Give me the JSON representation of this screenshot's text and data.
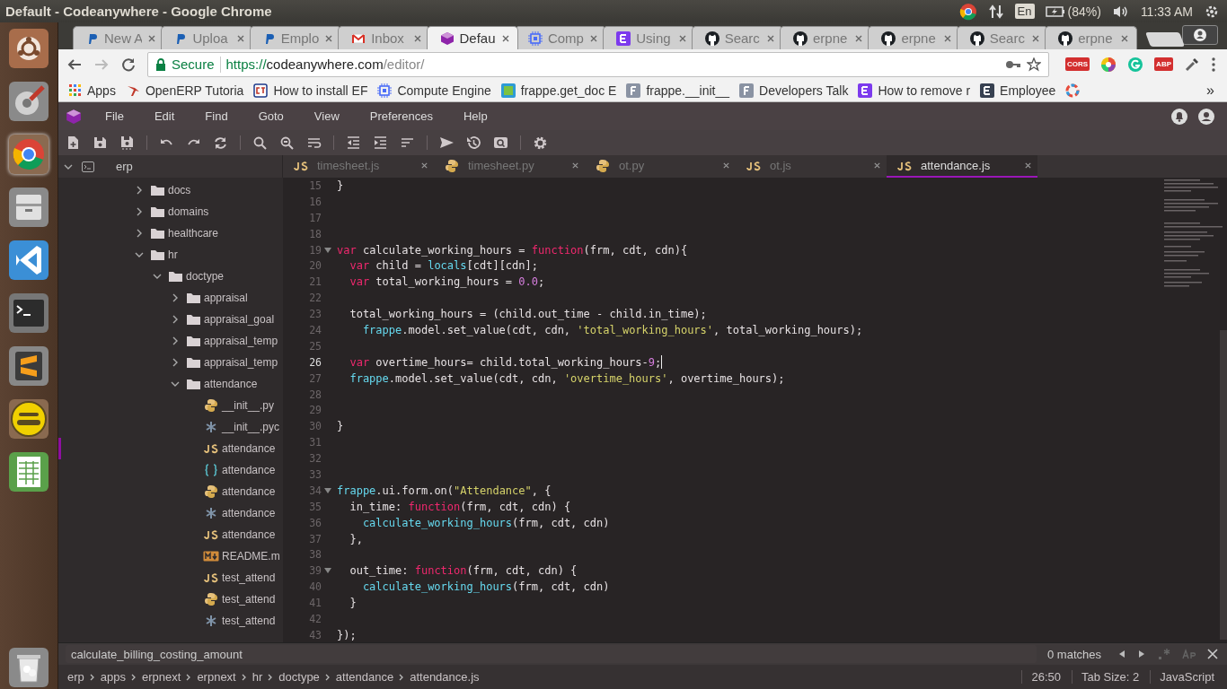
{
  "system_bar": {
    "title": "Default - Codeanywhere - Google Chrome",
    "keyboard": "En",
    "battery": "(84%)",
    "clock": "11:33 AM"
  },
  "launcher": [
    {
      "kind": "ubuntu",
      "selected": false
    },
    {
      "kind": "settings",
      "selected": false
    },
    {
      "kind": "chrome",
      "selected": true
    },
    {
      "kind": "files",
      "selected": false
    },
    {
      "kind": "vscode",
      "selected": false
    },
    {
      "kind": "terminal",
      "selected": false
    },
    {
      "kind": "sublime",
      "selected": false
    },
    {
      "kind": "badge",
      "selected": false
    },
    {
      "kind": "spreadsheet",
      "selected": false
    },
    {
      "kind": "trash",
      "selected": false
    }
  ],
  "browser": {
    "tabs": [
      {
        "label": "New A",
        "kind": "p",
        "selected": false
      },
      {
        "label": "Uploa",
        "kind": "p",
        "selected": false
      },
      {
        "label": "Emplo",
        "kind": "p",
        "selected": false
      },
      {
        "label": "Inbox",
        "kind": "mail",
        "selected": false
      },
      {
        "label": "Defau",
        "kind": "cube",
        "selected": true
      },
      {
        "label": "Comp",
        "kind": "chip",
        "selected": false
      },
      {
        "label": "Using",
        "kind": "e",
        "selected": false
      },
      {
        "label": "Searc",
        "kind": "github",
        "selected": false
      },
      {
        "label": "erpne",
        "kind": "github",
        "selected": false
      },
      {
        "label": "erpne",
        "kind": "github",
        "selected": false
      },
      {
        "label": "Searc",
        "kind": "github",
        "selected": false
      },
      {
        "label": "erpne",
        "kind": "github",
        "selected": false
      }
    ],
    "security": "Secure",
    "url": {
      "scheme": "https://",
      "host": "codeanywhere.com",
      "path": "/editor/"
    },
    "extensions": [
      {
        "kind": "badge",
        "label": "CORS"
      },
      {
        "kind": "color"
      },
      {
        "kind": "grammar"
      },
      {
        "kind": "badge",
        "label": "ABP"
      },
      {
        "kind": "dropper"
      }
    ],
    "bookmarks": [
      {
        "label": "Apps",
        "kind": "apps"
      },
      {
        "label": "OpenERP Tutoria",
        "kind": "bird"
      },
      {
        "label": "How to install EF",
        "kind": "ct"
      },
      {
        "label": "Compute Engine",
        "kind": "chip"
      },
      {
        "label": "frappe.get_doc E",
        "kind": "pt"
      },
      {
        "label": "frappe.__init__",
        "kind": "f"
      },
      {
        "label": "Developers Talk",
        "kind": "f"
      },
      {
        "label": "How to remove r",
        "kind": "e"
      },
      {
        "label": "Employee",
        "kind": "edark"
      },
      {
        "kind": "ring"
      }
    ],
    "more": "»"
  },
  "menu": [
    "File",
    "Edit",
    "Find",
    "Goto",
    "View",
    "Preferences",
    "Help"
  ],
  "file_tree": {
    "root": {
      "name": "erp",
      "expanded": true
    },
    "items": [
      {
        "name": "docs",
        "expanded": false
      },
      {
        "name": "domains",
        "expanded": false
      },
      {
        "name": "healthcare",
        "expanded": false
      },
      {
        "name": "hr",
        "expanded": true,
        "children": [
          {
            "name": "doctype",
            "expanded": true,
            "children": [
              {
                "name": "appraisal",
                "expanded": false
              },
              {
                "name": "appraisal_goal",
                "expanded": false
              },
              {
                "name": "appraisal_temp",
                "expanded": false
              },
              {
                "name": "appraisal_temp",
                "expanded": false
              },
              {
                "name": "attendance",
                "expanded": true,
                "children": [
                  {
                    "name": "__init__.py",
                    "kind": "python",
                    "selected": false
                  },
                  {
                    "name": "__init__.pyc",
                    "kind": "compiled",
                    "selected": false
                  },
                  {
                    "name": "attendance",
                    "kind": "js",
                    "selected": true
                  },
                  {
                    "name": "attendance",
                    "kind": "json",
                    "selected": false
                  },
                  {
                    "name": "attendance",
                    "kind": "python",
                    "selected": false
                  },
                  {
                    "name": "attendance",
                    "kind": "compiled",
                    "selected": false
                  },
                  {
                    "name": "attendance",
                    "kind": "js",
                    "selected": false
                  },
                  {
                    "name": "README.m",
                    "kind": "markdown",
                    "selected": false
                  },
                  {
                    "name": "test_attend",
                    "kind": "js",
                    "selected": false
                  },
                  {
                    "name": "test_attend",
                    "kind": "python",
                    "selected": false
                  },
                  {
                    "name": "test_attend",
                    "kind": "compiled",
                    "selected": false
                  }
                ]
              }
            ]
          }
        ]
      }
    ]
  },
  "editor_tabs": [
    {
      "label": "timesheet.js",
      "kind": "js",
      "selected": false
    },
    {
      "label": "timesheet.py",
      "kind": "python",
      "selected": false
    },
    {
      "label": "ot.py",
      "kind": "python",
      "selected": false
    },
    {
      "label": "ot.js",
      "kind": "js",
      "selected": false
    },
    {
      "label": "attendance.js",
      "kind": "js",
      "selected": true
    }
  ],
  "code_lines": [
    {
      "n": "15",
      "fold": false,
      "current": false,
      "tokens": [
        {
          "text": "}",
          "kind": "plain"
        }
      ]
    },
    {
      "n": "16",
      "fold": false,
      "current": false
    },
    {
      "n": "17",
      "fold": false,
      "current": false
    },
    {
      "n": "18",
      "fold": false,
      "current": false
    },
    {
      "n": "19",
      "fold": true,
      "current": false,
      "tokens": [
        {
          "text": "var",
          "kind": "keyword"
        },
        {
          "text": " calculate_working_hours = ",
          "kind": "plain"
        },
        {
          "text": "function",
          "kind": "keyword"
        },
        {
          "text": "(frm, cdt, cdn){",
          "kind": "plain"
        }
      ]
    },
    {
      "n": "20",
      "fold": false,
      "current": false,
      "tokens": [
        {
          "text": "  var",
          "kind": "keyword"
        },
        {
          "text": " child = ",
          "kind": "plain"
        },
        {
          "text": "locals",
          "kind": "builtin"
        },
        {
          "text": "[cdt][cdn];",
          "kind": "plain"
        }
      ]
    },
    {
      "n": "21",
      "fold": false,
      "current": false,
      "tokens": [
        {
          "text": "  var",
          "kind": "keyword"
        },
        {
          "text": " total_working_hours = ",
          "kind": "plain"
        },
        {
          "text": "0.0",
          "kind": "number"
        },
        {
          "text": ";",
          "kind": "plain"
        }
      ]
    },
    {
      "n": "22",
      "fold": false,
      "current": false
    },
    {
      "n": "23",
      "fold": false,
      "current": false,
      "tokens": [
        {
          "text": "  total_working_hours = (child.out_time - child.in_time);",
          "kind": "plain"
        }
      ]
    },
    {
      "n": "24",
      "fold": false,
      "current": false,
      "tokens": [
        {
          "text": "    frappe",
          "kind": "builtin"
        },
        {
          "text": ".model.set_value(cdt, cdn, ",
          "kind": "plain"
        },
        {
          "text": "'total_working_hours'",
          "kind": "string"
        },
        {
          "text": ", total_working_hours);",
          "kind": "plain"
        }
      ]
    },
    {
      "n": "25",
      "fold": false,
      "current": false
    },
    {
      "n": "26",
      "fold": false,
      "current": true,
      "tokens": [
        {
          "text": "  var",
          "kind": "keyword"
        },
        {
          "text": " overtime_hours= child.total_working_hours-",
          "kind": "plain"
        },
        {
          "text": "9",
          "kind": "number"
        },
        {
          "text": ";",
          "kind": "plain"
        }
      ]
    },
    {
      "n": "27",
      "fold": false,
      "current": false,
      "tokens": [
        {
          "text": "  frappe",
          "kind": "builtin"
        },
        {
          "text": ".model.set_value(cdt, cdn, ",
          "kind": "plain"
        },
        {
          "text": "'overtime_hours'",
          "kind": "string"
        },
        {
          "text": ", overtime_hours);",
          "kind": "plain"
        }
      ]
    },
    {
      "n": "28",
      "fold": false,
      "current": false
    },
    {
      "n": "29",
      "fold": false,
      "current": false
    },
    {
      "n": "30",
      "fold": false,
      "current": false,
      "tokens": [
        {
          "text": "}",
          "kind": "plain"
        }
      ]
    },
    {
      "n": "31",
      "fold": false,
      "current": false
    },
    {
      "n": "32",
      "fold": false,
      "current": false
    },
    {
      "n": "33",
      "fold": false,
      "current": false
    },
    {
      "n": "34",
      "fold": true,
      "current": false,
      "tokens": [
        {
          "text": "frappe",
          "kind": "builtin"
        },
        {
          "text": ".ui.form.on(",
          "kind": "plain"
        },
        {
          "text": "\"Attendance\"",
          "kind": "string"
        },
        {
          "text": ", {",
          "kind": "plain"
        }
      ]
    },
    {
      "n": "35",
      "fold": false,
      "current": false,
      "tokens": [
        {
          "text": "  in_time: ",
          "kind": "plain"
        },
        {
          "text": "function",
          "kind": "keyword"
        },
        {
          "text": "(frm, cdt, cdn) {",
          "kind": "plain"
        }
      ]
    },
    {
      "n": "36",
      "fold": false,
      "current": false,
      "tokens": [
        {
          "text": "    calculate_working_hours",
          "kind": "builtin"
        },
        {
          "text": "(frm, cdt, cdn)",
          "kind": "plain"
        }
      ]
    },
    {
      "n": "37",
      "fold": false,
      "current": false,
      "tokens": [
        {
          "text": "  },",
          "kind": "plain"
        }
      ]
    },
    {
      "n": "38",
      "fold": false,
      "current": false
    },
    {
      "n": "39",
      "fold": true,
      "current": false,
      "tokens": [
        {
          "text": "  out_time: ",
          "kind": "plain"
        },
        {
          "text": "function",
          "kind": "keyword"
        },
        {
          "text": "(frm, cdt, cdn) {",
          "kind": "plain"
        }
      ]
    },
    {
      "n": "40",
      "fold": false,
      "current": false,
      "tokens": [
        {
          "text": "    calculate_working_hours",
          "kind": "builtin"
        },
        {
          "text": "(frm, cdt, cdn)",
          "kind": "plain"
        }
      ]
    },
    {
      "n": "41",
      "fold": false,
      "current": false,
      "tokens": [
        {
          "text": "  }",
          "kind": "plain"
        }
      ]
    },
    {
      "n": "42",
      "fold": false,
      "current": false
    },
    {
      "n": "43",
      "fold": false,
      "current": false,
      "tokens": [
        {
          "text": "});",
          "kind": "plain"
        }
      ]
    }
  ],
  "find_bar": {
    "value": "calculate_billing_costing_amount",
    "matches": "0 matches"
  },
  "status_bar": {
    "path": [
      "erp",
      "apps",
      "erpnext",
      "erpnext",
      "hr",
      "doctype",
      "attendance",
      "attendance.js"
    ],
    "position": "26:50",
    "tab_size": "Tab Size: 2",
    "language": "JavaScript"
  }
}
